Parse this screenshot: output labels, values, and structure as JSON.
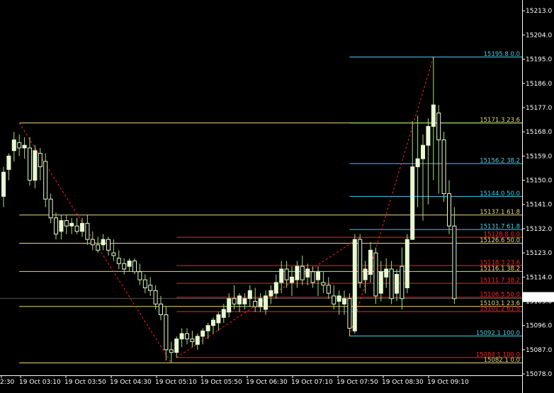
{
  "chart_data": {
    "type": "candlestick",
    "colors": {
      "background": "#000000",
      "candle_body": "#e8f8d0",
      "candle_wick": "#a8e078",
      "axis": "#ffffff",
      "fib_yellow": "#e8d878",
      "fib_red": "#ff2020",
      "fib_cyan": "#40d0e8",
      "fib_green": "#a8f070",
      "dash_line": "#ff2020",
      "price_box_border": "#ffffff",
      "price_box_bg": "#ffffff",
      "price_box_text": "#000000"
    },
    "y_axis": {
      "min": 15077.5,
      "max": 15217,
      "ticks": [
        15213.0,
        15204.0,
        15195.0,
        15186.0,
        15177.0,
        15168.0,
        15159.0,
        15150.0,
        15141.0,
        15132.0,
        15123.0,
        15114.0,
        15105.0,
        15096.0,
        15087.0,
        15078.0
      ],
      "current_price": "15106.1"
    },
    "x_axis": {
      "tick_labels": [
        "2:30",
        "19 Oct 03:10",
        "19 Oct 03:50",
        "19 Oct 04:30",
        "19 Oct 05:10",
        "19 Oct 05:50",
        "19 Oct 06:30",
        "19 Oct 07:10",
        "19 Oct 07:50",
        "19 Oct 08:30",
        "19 Oct 09:10"
      ]
    },
    "candles": [
      {
        "o": 15144,
        "h": 15155,
        "l": 15140,
        "c": 15153
      },
      {
        "o": 15154,
        "h": 15160,
        "l": 15150,
        "c": 15159
      },
      {
        "o": 15161,
        "h": 15168,
        "l": 15157,
        "c": 15165
      },
      {
        "o": 15164,
        "h": 15167,
        "l": 15159,
        "c": 15162
      },
      {
        "o": 15162,
        "h": 15166,
        "l": 15158,
        "c": 15163
      },
      {
        "o": 15162,
        "h": 15166,
        "l": 15148,
        "c": 15150
      },
      {
        "o": 15150,
        "h": 15163,
        "l": 15147,
        "c": 15161
      },
      {
        "o": 15160,
        "h": 15162,
        "l": 15150,
        "c": 15155
      },
      {
        "o": 15157,
        "h": 15160,
        "l": 15140,
        "c": 15143
      },
      {
        "o": 15143,
        "h": 15145,
        "l": 15134,
        "c": 15136
      },
      {
        "o": 15136,
        "h": 15138,
        "l": 15128,
        "c": 15130
      },
      {
        "o": 15131,
        "h": 15137,
        "l": 15128,
        "c": 15135
      },
      {
        "o": 15135,
        "h": 15137,
        "l": 15130,
        "c": 15133
      },
      {
        "o": 15133,
        "h": 15136,
        "l": 15130,
        "c": 15134
      },
      {
        "o": 15133,
        "h": 15136,
        "l": 15130,
        "c": 15131
      },
      {
        "o": 15131,
        "h": 15136,
        "l": 15129,
        "c": 15134
      },
      {
        "o": 15134,
        "h": 15137,
        "l": 15126,
        "c": 15128
      },
      {
        "o": 15128,
        "h": 15131,
        "l": 15124,
        "c": 15126
      },
      {
        "o": 15126,
        "h": 15129,
        "l": 15123,
        "c": 15124
      },
      {
        "o": 15126,
        "h": 15130,
        "l": 15124,
        "c": 15128
      },
      {
        "o": 15128,
        "h": 15129,
        "l": 15122,
        "c": 15124
      },
      {
        "o": 15123,
        "h": 15128,
        "l": 15120,
        "c": 15122
      },
      {
        "o": 15121,
        "h": 15124,
        "l": 15117,
        "c": 15119
      },
      {
        "o": 15119,
        "h": 15121,
        "l": 15115,
        "c": 15117
      },
      {
        "o": 15118,
        "h": 15121,
        "l": 15116,
        "c": 15120
      },
      {
        "o": 15120,
        "h": 15121,
        "l": 15115,
        "c": 15116
      },
      {
        "o": 15116,
        "h": 15119,
        "l": 15111,
        "c": 15113
      },
      {
        "o": 15113,
        "h": 15115,
        "l": 15108,
        "c": 15110
      },
      {
        "o": 15111,
        "h": 15114,
        "l": 15107,
        "c": 15109
      },
      {
        "o": 15109,
        "h": 15111,
        "l": 15102,
        "c": 15104
      },
      {
        "o": 15104,
        "h": 15107,
        "l": 15098,
        "c": 15100
      },
      {
        "o": 15100,
        "h": 15103,
        "l": 15083,
        "c": 15087
      },
      {
        "o": 15087,
        "h": 15090,
        "l": 15082,
        "c": 15086
      },
      {
        "o": 15086,
        "h": 15092,
        "l": 15084,
        "c": 15091
      },
      {
        "o": 15091,
        "h": 15095,
        "l": 15088,
        "c": 15093
      },
      {
        "o": 15093,
        "h": 15095,
        "l": 15089,
        "c": 15091
      },
      {
        "o": 15091,
        "h": 15094,
        "l": 15088,
        "c": 15090
      },
      {
        "o": 15089,
        "h": 15093,
        "l": 15087,
        "c": 15092
      },
      {
        "o": 15092,
        "h": 15095,
        "l": 15089,
        "c": 15094
      },
      {
        "o": 15094,
        "h": 15097,
        "l": 15091,
        "c": 15096
      },
      {
        "o": 15096,
        "h": 15099,
        "l": 15093,
        "c": 15098
      },
      {
        "o": 15097,
        "h": 15101,
        "l": 15094,
        "c": 15100
      },
      {
        "o": 15099,
        "h": 15104,
        "l": 15097,
        "c": 15102
      },
      {
        "o": 15101,
        "h": 15108,
        "l": 15099,
        "c": 15106
      },
      {
        "o": 15106,
        "h": 15111,
        "l": 15102,
        "c": 15104
      },
      {
        "o": 15104,
        "h": 15108,
        "l": 15101,
        "c": 15107
      },
      {
        "o": 15104,
        "h": 15108,
        "l": 15102,
        "c": 15106
      },
      {
        "o": 15106,
        "h": 15111,
        "l": 15103,
        "c": 15109
      },
      {
        "o": 15105,
        "h": 15110,
        "l": 15101,
        "c": 15103
      },
      {
        "o": 15103,
        "h": 15108,
        "l": 15101,
        "c": 15106
      },
      {
        "o": 15102,
        "h": 15109,
        "l": 15100,
        "c": 15107
      },
      {
        "o": 15107,
        "h": 15111,
        "l": 15104,
        "c": 15109
      },
      {
        "o": 15108,
        "h": 15115,
        "l": 15106,
        "c": 15112
      },
      {
        "o": 15112,
        "h": 15120,
        "l": 15108,
        "c": 15117
      },
      {
        "o": 15117,
        "h": 15120,
        "l": 15110,
        "c": 15113
      },
      {
        "o": 15112,
        "h": 15118,
        "l": 15107,
        "c": 15114
      },
      {
        "o": 15113,
        "h": 15120,
        "l": 15110,
        "c": 15118
      },
      {
        "o": 15118,
        "h": 15122,
        "l": 15111,
        "c": 15113
      },
      {
        "o": 15114,
        "h": 15119,
        "l": 15111,
        "c": 15117
      },
      {
        "o": 15116,
        "h": 15118,
        "l": 15110,
        "c": 15112
      },
      {
        "o": 15113,
        "h": 15118,
        "l": 15107,
        "c": 15116
      },
      {
        "o": 15112,
        "h": 15116,
        "l": 15108,
        "c": 15111
      },
      {
        "o": 15111,
        "h": 15114,
        "l": 15106,
        "c": 15108
      },
      {
        "o": 15107,
        "h": 15111,
        "l": 15102,
        "c": 15104
      },
      {
        "o": 15105,
        "h": 15109,
        "l": 15100,
        "c": 15107
      },
      {
        "o": 15104,
        "h": 15109,
        "l": 15100,
        "c": 15106
      },
      {
        "o": 15106,
        "h": 15108,
        "l": 15092,
        "c": 15095
      },
      {
        "o": 15094,
        "h": 15130,
        "l": 15093,
        "c": 15128
      },
      {
        "o": 15128,
        "h": 15130,
        "l": 15110,
        "c": 15112
      },
      {
        "o": 15113,
        "h": 15120,
        "l": 15108,
        "c": 15117
      },
      {
        "o": 15115,
        "h": 15127,
        "l": 15112,
        "c": 15124
      },
      {
        "o": 15123,
        "h": 15125,
        "l": 15104,
        "c": 15107
      },
      {
        "o": 15108,
        "h": 15120,
        "l": 15105,
        "c": 15116
      },
      {
        "o": 15114,
        "h": 15121,
        "l": 15110,
        "c": 15117
      },
      {
        "o": 15117,
        "h": 15120,
        "l": 15104,
        "c": 15106
      },
      {
        "o": 15108,
        "h": 15117,
        "l": 15105,
        "c": 15115
      },
      {
        "o": 15118,
        "h": 15125,
        "l": 15102,
        "c": 15106
      },
      {
        "o": 15110,
        "h": 15130,
        "l": 15108,
        "c": 15128
      },
      {
        "o": 15128,
        "h": 15172,
        "l": 15128,
        "c": 15155
      },
      {
        "o": 15155,
        "h": 15174,
        "l": 15140,
        "c": 15158
      },
      {
        "o": 15158,
        "h": 15167,
        "l": 15135,
        "c": 15163
      },
      {
        "o": 15163,
        "h": 15173,
        "l": 15141,
        "c": 15170
      },
      {
        "o": 15170,
        "h": 15196,
        "l": 15150,
        "c": 15178
      },
      {
        "o": 15175,
        "h": 15178,
        "l": 15145,
        "c": 15165
      },
      {
        "o": 15165,
        "h": 15168,
        "l": 15142,
        "c": 15145
      },
      {
        "o": 15145,
        "h": 15150,
        "l": 15130,
        "c": 15133
      },
      {
        "o": 15133,
        "h": 15140,
        "l": 15104,
        "c": 15106
      }
    ],
    "fib_left": {
      "lines": [
        {
          "price": 15171.3,
          "color": "yellow"
        },
        {
          "price": 15137.1,
          "color": "yellow"
        },
        {
          "price": 15126.6,
          "color": "yellow"
        },
        {
          "price": 15116.1,
          "color": "yellow"
        },
        {
          "price": 15103.1,
          "color": "yellow"
        },
        {
          "price": 15082.1,
          "color": "yellow"
        }
      ]
    },
    "fib_labels": [
      {
        "text": "15195.8 0.0",
        "price": 15195.8,
        "color": "cyan"
      },
      {
        "text": "15171.3 23.6",
        "price": 15171.3,
        "color": "yellow"
      },
      {
        "text": "15156.2 38.2",
        "price": 15156.2,
        "color": "cyan"
      },
      {
        "text": "15144.0 50.0",
        "price": 15144.0,
        "color": "cyan"
      },
      {
        "text": "15137.1 61.8",
        "price": 15137.1,
        "color": "yellow"
      },
      {
        "text": "15131.7 61.8",
        "price": 15131.7,
        "color": "cyan"
      },
      {
        "text": "15128.8 0.0",
        "price": 15128.8,
        "color": "red"
      },
      {
        "text": "15126.6 50.0",
        "price": 15126.6,
        "color": "yellow"
      },
      {
        "text": "15118.3 23.6",
        "price": 15118.3,
        "color": "red"
      },
      {
        "text": "15116.1 38.2",
        "price": 15116.1,
        "color": "yellow"
      },
      {
        "text": "15111.7 38.2",
        "price": 15111.7,
        "color": "red"
      },
      {
        "text": "15106.5 50.0",
        "price": 15106.5,
        "color": "red"
      },
      {
        "text": "15103.1 23.6",
        "price": 15103.1,
        "color": "yellow"
      },
      {
        "text": "15101.2 61.8",
        "price": 15101.2,
        "color": "red"
      },
      {
        "text": "15092.1 100.0",
        "price": 15092.1,
        "color": "cyan"
      },
      {
        "text": "15084.1 100.0",
        "price": 15084.1,
        "color": "red"
      },
      {
        "text": "15082.1 0.0",
        "price": 15082.1,
        "color": "yellow"
      }
    ]
  }
}
